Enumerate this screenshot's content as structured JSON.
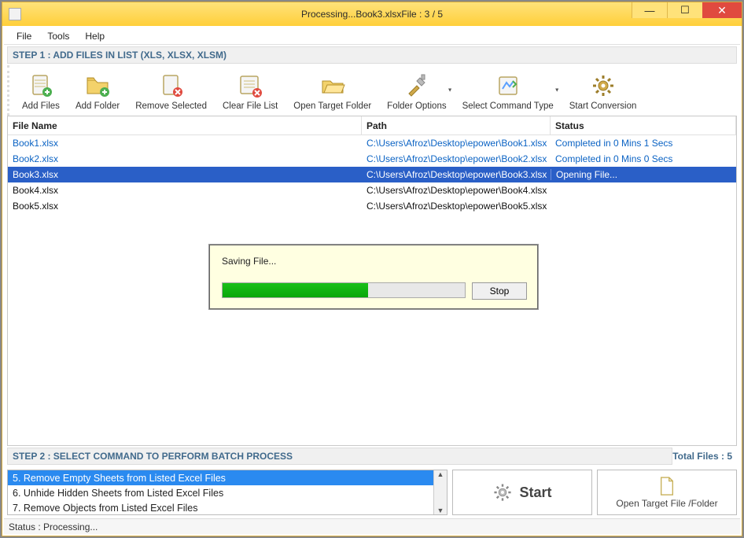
{
  "window": {
    "title": "Processing...Book3.xlsxFile : 3 / 5"
  },
  "menus": {
    "file": "File",
    "tools": "Tools",
    "help": "Help"
  },
  "step1_header": "STEP 1 : ADD FILES IN LIST (XLS, XLSX, XLSM)",
  "toolbar": {
    "add_files": "Add Files",
    "add_folder": "Add Folder",
    "remove_selected": "Remove Selected",
    "clear_file_list": "Clear File List",
    "open_target_folder": "Open Target Folder",
    "folder_options": "Folder Options",
    "select_command_type": "Select Command Type",
    "start_conversion": "Start Conversion"
  },
  "columns": {
    "name": "File Name",
    "path": "Path",
    "status": "Status"
  },
  "files": [
    {
      "name": "Book1.xlsx",
      "path": "C:\\Users\\Afroz\\Desktop\\epower\\Book1.xlsx",
      "status": "Completed in 0 Mins 1 Secs",
      "state": "completed"
    },
    {
      "name": "Book2.xlsx",
      "path": "C:\\Users\\Afroz\\Desktop\\epower\\Book2.xlsx",
      "status": "Completed in 0 Mins 0 Secs",
      "state": "completed"
    },
    {
      "name": "Book3.xlsx",
      "path": "C:\\Users\\Afroz\\Desktop\\epower\\Book3.xlsx",
      "status": "Opening File...",
      "state": "selected"
    },
    {
      "name": "Book4.xlsx",
      "path": "C:\\Users\\Afroz\\Desktop\\epower\\Book4.xlsx",
      "status": "",
      "state": "plain"
    },
    {
      "name": "Book5.xlsx",
      "path": "C:\\Users\\Afroz\\Desktop\\epower\\Book5.xlsx",
      "status": "",
      "state": "plain"
    }
  ],
  "popup": {
    "message": "Saving File...",
    "progress_percent": 60,
    "stop": "Stop"
  },
  "step2_header": "STEP 2 : SELECT COMMAND TO PERFORM BATCH PROCESS",
  "total_files_label": "Total Files : 5",
  "commands": {
    "items": [
      {
        "label": "5. Remove Empty Sheets from Listed Excel Files",
        "selected": true
      },
      {
        "label": "6. Unhide Hidden Sheets from Listed Excel Files",
        "selected": false
      },
      {
        "label": "7. Remove Objects from Listed Excel Files",
        "selected": false
      }
    ],
    "scroll_up": "▲",
    "scroll_down": "▼"
  },
  "buttons": {
    "start": "Start",
    "open_target": "Open Target File /Folder"
  },
  "statusbar": "Status  :  Processing...",
  "colors": {
    "accent": "#2a5fc7",
    "title_bg": "#ffd24a",
    "popup_bg": "#ffffe1",
    "progress": "#0aa60a"
  }
}
